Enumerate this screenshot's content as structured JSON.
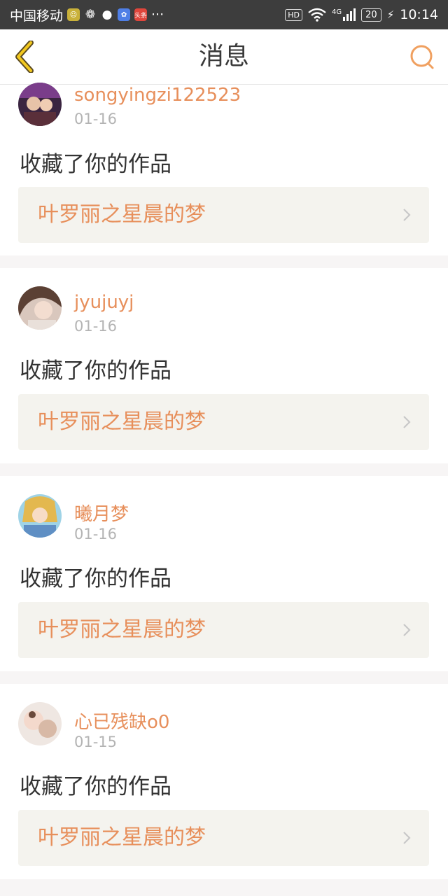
{
  "status_bar": {
    "carrier": "中国移动",
    "app_badge": "头条",
    "more": "···",
    "hd": "HD",
    "network": "4G",
    "battery": "20",
    "time": "10:14"
  },
  "header": {
    "title": "消息",
    "back_icon": "chevron-left-icon",
    "search_icon": "search-icon"
  },
  "colors": {
    "accent": "#e78f5b",
    "card_inner_bg": "#f4f3ee",
    "page_bg": "#f7f5f5",
    "status_bar_bg": "#3d3d3d"
  },
  "messages": [
    {
      "username": "songyingzi122523",
      "date": "01-16",
      "action": "收藏了你的作品",
      "work_title": "叶罗丽之星晨的梦"
    },
    {
      "username": "jyujuyj",
      "date": "01-16",
      "action": "收藏了你的作品",
      "work_title": "叶罗丽之星晨的梦"
    },
    {
      "username": "曦月梦",
      "date": "01-16",
      "action": "收藏了你的作品",
      "work_title": "叶罗丽之星晨的梦"
    },
    {
      "username": "心已残缺o0",
      "date": "01-15",
      "action": "收藏了你的作品",
      "work_title": "叶罗丽之星晨的梦"
    }
  ]
}
